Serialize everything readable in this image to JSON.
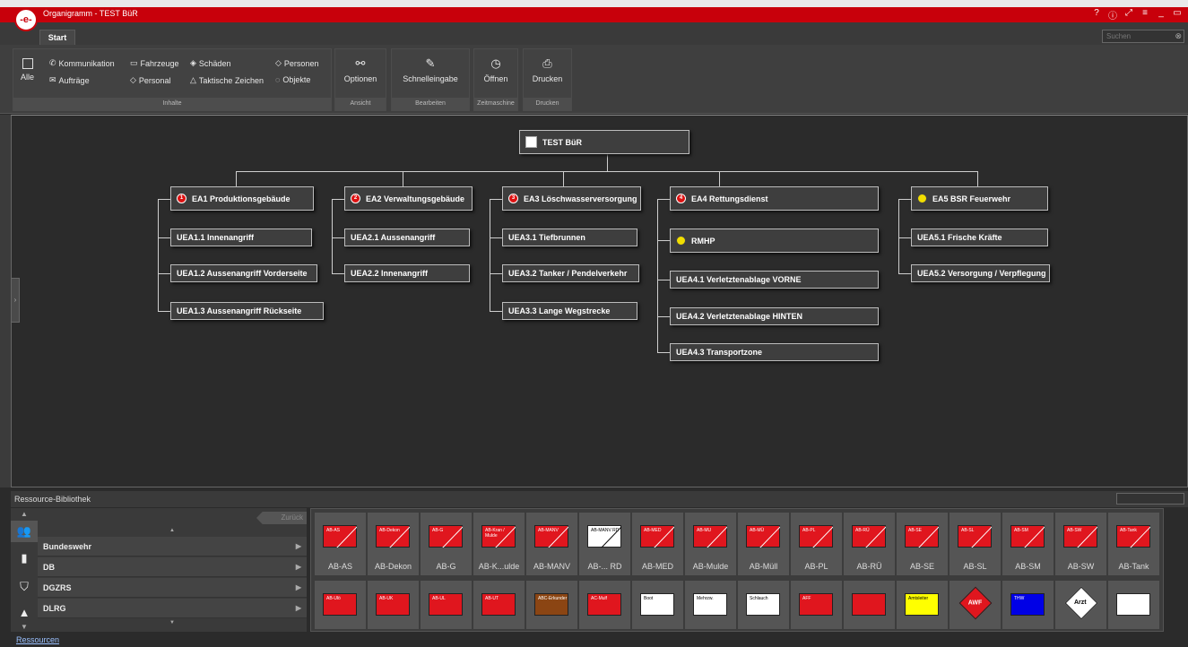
{
  "window": {
    "title": "Organigramm - TEST BüR",
    "logo": "-e-",
    "controls": [
      "help-icon",
      "info-icon",
      "fullscreen-icon",
      "menu-icon",
      "minimize-icon",
      "restore-icon"
    ]
  },
  "tabs": {
    "start": "Start"
  },
  "search": {
    "placeholder": "Suchen"
  },
  "ribbon": {
    "inhalte": {
      "alle": "Alle",
      "kommunikation": "Kommunikation",
      "auftraege": "Aufträge",
      "fahrzeuge": "Fahrzeuge",
      "personal": "Personal",
      "schaeden": "Schäden",
      "taktische": "Taktische Zeichen",
      "personen": "Personen",
      "objekte": "Objekte",
      "label": "Inhalte"
    },
    "ansicht": {
      "optionen": "Optionen",
      "label": "Ansicht"
    },
    "bearbeiten": {
      "schnelleingabe": "Schnelleingabe",
      "label": "Bearbeiten"
    },
    "zeitmaschine": {
      "oeffnen": "Öffnen",
      "label": "Zeitmaschine"
    },
    "drucken": {
      "drucken": "Drucken",
      "label": "Drucken"
    }
  },
  "org": {
    "root": "TEST BüR",
    "ea1": "EA1 Produktionsgebäude",
    "ea1_badge": "1",
    "ea2": "EA2 Verwaltungsgebäude",
    "ea2_badge": "2",
    "ea3": "EA3 Löschwasserversorgung",
    "ea3_badge": "3",
    "ea4": "EA4 Rettungsdienst",
    "ea4_badge": "4",
    "ea5": "EA5 BSR Feuerwehr",
    "uea11": "UEA1.1 Innenangriff",
    "uea12": "UEA1.2 Aussenangriff Vorderseite",
    "uea13": "UEA1.3 Aussenangriff Rückseite",
    "uea21": "UEA2.1 Aussenangriff",
    "uea22": "UEA2.2 Innenangriff",
    "uea31": "UEA3.1  Tiefbrunnen",
    "uea32": "UEA3.2 Tanker / Pendelverkehr",
    "uea33": "UEA3.3 Lange Wegstrecke",
    "rmhp": "RMHP",
    "uea41": "UEA4.1 Verletztenablage VORNE",
    "uea42": "UEA4.2 Verletztenablage HINTEN",
    "uea43": "UEA4.3 Transportzone",
    "uea51": "UEA5.1 Frische Kräfte",
    "uea52": "UEA5.2 Versorgung / Verpflegung"
  },
  "library": {
    "title": "Ressource-Bibliothek",
    "back": "Zurück",
    "categories": [
      "Bundeswehr",
      "DB",
      "DGZRS",
      "DLRG"
    ],
    "row1": [
      "AB-AS",
      "AB-Dekon",
      "AB-G",
      "AB-K...ulde",
      "AB-MANV",
      "AB-... RD",
      "AB-MED",
      "AB-Mulde",
      "AB-Müll",
      "AB-PL",
      "AB-RÜ",
      "AB-SE",
      "AB-SL",
      "AB-SM",
      "AB-SW",
      "AB-Tank"
    ],
    "row1_tags": [
      "AB-AS",
      "AB-Dekon",
      "AB-G",
      "AB-Kran / Mulde",
      "AB-MANV",
      "AB-MANV RD",
      "AB-MED",
      "AB-MU",
      "AB-MÜ",
      "AB-PL",
      "AB-RÜ",
      "AB-SE",
      "AB-SL",
      "AB-SM",
      "AB-SW",
      "AB-Tank"
    ],
    "row2_tags": [
      "AB-Ulö",
      "AB-UK",
      "AB-UL",
      "AB-UT",
      "ABC-Erkunder",
      "AC-Mulf",
      "Boot",
      "Mehrzw.",
      "Schlauch",
      "AFF",
      "",
      "Amtsleiter",
      "AWF",
      "THW",
      "Arzt",
      ""
    ]
  },
  "footer": {
    "link": "Ressourcen"
  }
}
